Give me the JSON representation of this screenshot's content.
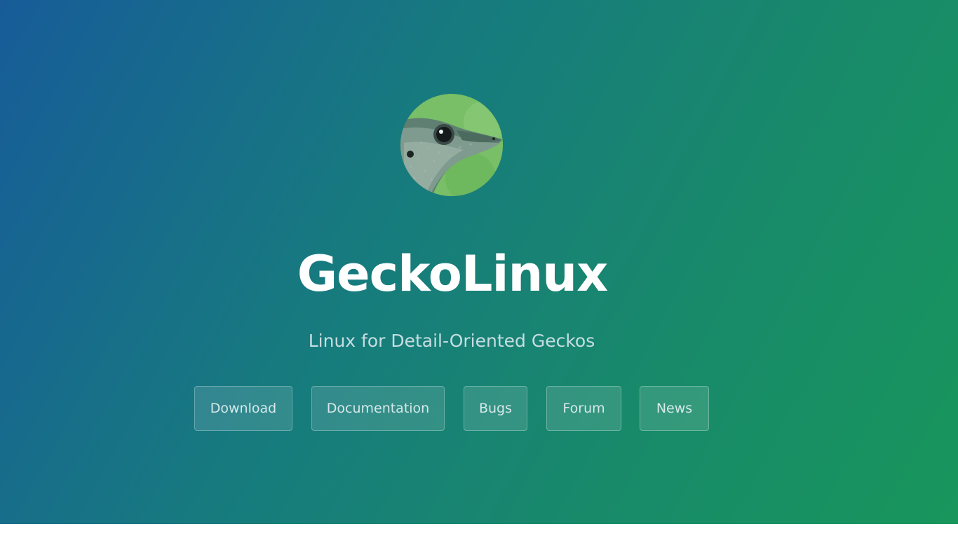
{
  "logo": {
    "icon": "gecko-head-icon",
    "alt": "Gecko head logo"
  },
  "site": {
    "title": "GeckoLinux",
    "tagline": "Linux for Detail-Oriented Geckos"
  },
  "nav": {
    "download": "Download",
    "documentation": "Documentation",
    "bugs": "Bugs",
    "forum": "Forum",
    "news": "News"
  },
  "colors": {
    "gradient_start": "#175c99",
    "gradient_end": "#18965c",
    "title": "#ffffff",
    "tagline": "#c7dde2"
  }
}
